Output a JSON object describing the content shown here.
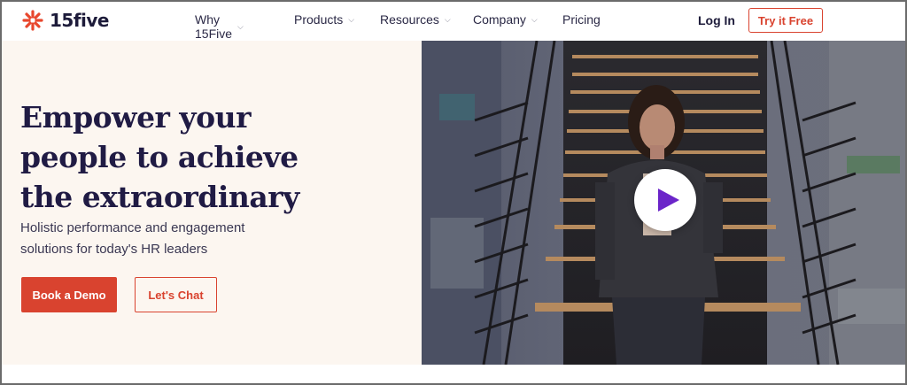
{
  "brand": {
    "logo_text": "15five",
    "accent": "#d9432f",
    "navy": "#201b44"
  },
  "nav": {
    "items": [
      {
        "label": "Why 15Five",
        "has_dropdown": true
      },
      {
        "label": "Products",
        "has_dropdown": true
      },
      {
        "label": "Resources",
        "has_dropdown": true
      },
      {
        "label": "Company",
        "has_dropdown": true
      },
      {
        "label": "Pricing",
        "has_dropdown": false
      }
    ],
    "login_label": "Log In",
    "cta_label": "Try it Free"
  },
  "hero": {
    "headline_lines": [
      "Empower your",
      "people to achieve",
      "the extraordinary"
    ],
    "subheadline_lines": [
      "Holistic performance and engagement",
      "solutions for today's HR leaders"
    ],
    "primary_button": "Book a Demo",
    "secondary_button": "Let's Chat",
    "video": {
      "play_icon": "play-icon"
    }
  },
  "icons": {
    "logo": "starburst-logo-icon",
    "dropdown": "chevron-down-icon",
    "play": "play-icon"
  }
}
